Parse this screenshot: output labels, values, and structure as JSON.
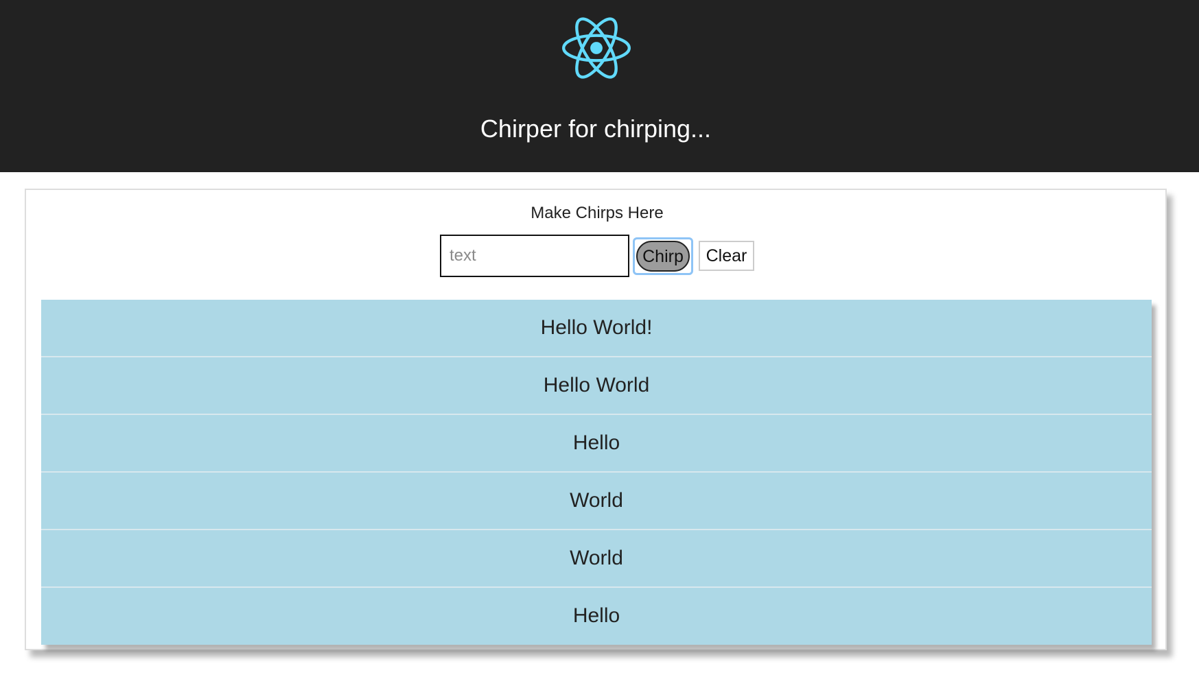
{
  "header": {
    "logo_icon": "react-atom-icon",
    "logo_color": "#61dafb",
    "title": "Chirper for chirping...",
    "background": "#222222"
  },
  "composer": {
    "heading": "Make Chirps Here",
    "input_value": "",
    "input_placeholder": "text",
    "chirp_label": "Chirp",
    "clear_label": "Clear"
  },
  "chirps": [
    {
      "text": "Hello World!"
    },
    {
      "text": "Hello World"
    },
    {
      "text": "Hello"
    },
    {
      "text": "World"
    },
    {
      "text": "World"
    },
    {
      "text": "Hello"
    }
  ],
  "colors": {
    "chirp_background": "#add8e6",
    "focus_ring": "#8ec4f6"
  }
}
